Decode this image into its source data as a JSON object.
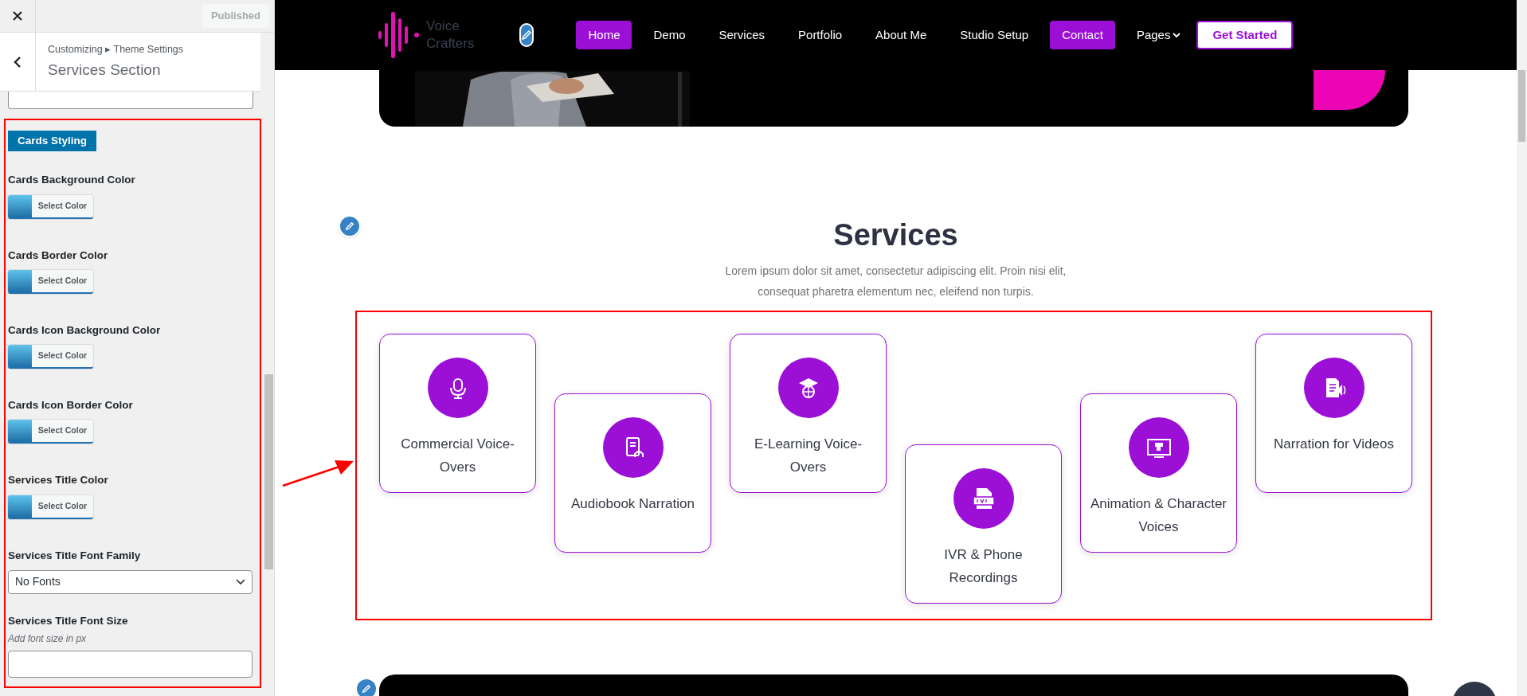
{
  "customizer": {
    "publish_button": {
      "label": "Published",
      "disabled": true
    },
    "breadcrumb": "Customizing ▸ Theme Settings",
    "title": "Services Section",
    "controls": [
      {
        "kind": "heading",
        "label": "Cards Styling"
      },
      {
        "kind": "color",
        "label": "Cards Background Color",
        "button": "Select Color"
      },
      {
        "kind": "color",
        "label": "Cards Border Color",
        "button": "Select Color"
      },
      {
        "kind": "color",
        "label": "Cards Icon Background Color",
        "button": "Select Color"
      },
      {
        "kind": "color",
        "label": "Cards Icon Border Color",
        "button": "Select Color"
      },
      {
        "kind": "color",
        "label": "Services Title Color",
        "button": "Select Color"
      },
      {
        "kind": "select",
        "label": "Services Title Font Family",
        "value": "No Fonts"
      },
      {
        "kind": "text",
        "label": "Services Title Font Size",
        "description": "Add font size in px"
      }
    ]
  },
  "site": {
    "logo": [
      "Voice",
      "Crafters"
    ],
    "nav": [
      {
        "label": "Home",
        "highlighted": true,
        "dropdown": false
      },
      {
        "label": "Demo",
        "highlighted": false,
        "dropdown": false
      },
      {
        "label": "Services",
        "highlighted": false,
        "dropdown": false
      },
      {
        "label": "Portfolio",
        "highlighted": false,
        "dropdown": false
      },
      {
        "label": "About Me",
        "highlighted": false,
        "dropdown": false
      },
      {
        "label": "Studio Setup",
        "highlighted": false,
        "dropdown": false
      },
      {
        "label": "Contact",
        "highlighted": true,
        "dropdown": false
      },
      {
        "label": "Pages",
        "highlighted": false,
        "dropdown": true
      }
    ],
    "cta": "Get Started"
  },
  "services": {
    "title": "Services",
    "subtitle": "Lorem ipsum dolor sit amet, consectetur adipiscing elit. Proin nisi elit, consequat pharetra elementum nec, eleifend non turpis.",
    "cards": [
      {
        "title": "Commercial Voice-Overs"
      },
      {
        "title": "Audiobook Narration"
      },
      {
        "title": "E-Learning Voice-Overs"
      },
      {
        "title": "IVR & Phone Recordings"
      },
      {
        "title": "Animation & Character Voices"
      },
      {
        "title": "Narration for Videos"
      }
    ]
  }
}
